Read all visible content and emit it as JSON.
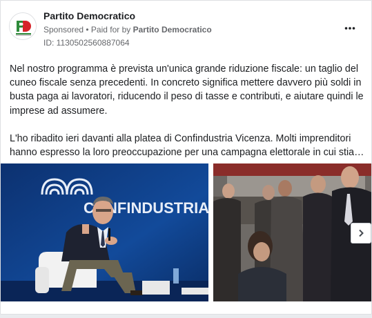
{
  "post": {
    "page_name": "Partito Democratico",
    "sponsored": "Sponsored",
    "paid_for_prefix": " • Paid for by ",
    "paid_for_by": "Partito Democratico",
    "ad_id": "ID: 1130502560887064",
    "more_icon": "more-horizontal-icon",
    "avatar_logo_text": "Partito Democratico",
    "paragraph1_line1": "Nel nostro programma è prevista un'unica grande riduzione fiscale: un taglio del",
    "paragraph1_line2": "cuneo fiscale senza precedenti. In concreto significa mettere davvero più soldi in",
    "paragraph1_line3": "busta paga ai lavoratori, riducendo il peso di tasse e contributi, e aiutare quindi le",
    "paragraph1_line4": "imprese ad assumere.",
    "paragraph2_line1": "L'ho ribadito ieri davanti alla platea di Confindustria Vicenza. Molti imprenditori",
    "paragraph2_line2": "hanno espresso la loro preoccupazione per una campagna elettorale in cui stiamo assistendo"
  },
  "media": {
    "image1_backdrop_text": "CONFINDUSTRIA V",
    "next_icon": "chevron-right-icon"
  },
  "colors": {
    "pd_green": "#2e8b3a",
    "pd_red": "#d6242a",
    "stage_blue": "#0f3b7d"
  }
}
